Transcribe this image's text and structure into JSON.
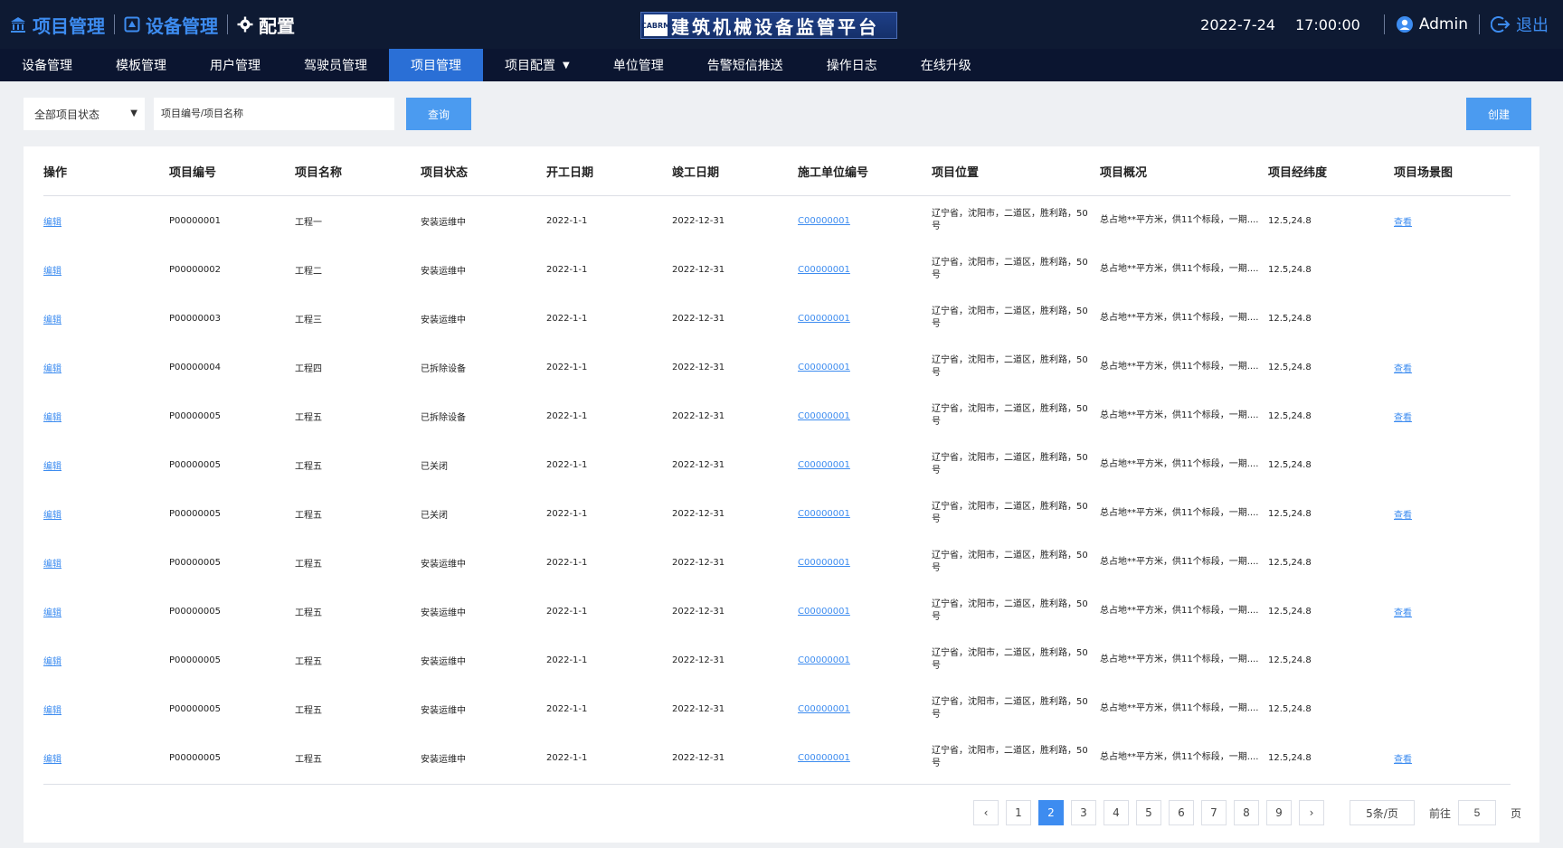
{
  "header": {
    "links": [
      {
        "label": "项目管理",
        "icon": "building-icon"
      },
      {
        "label": "设备管理",
        "icon": "device-icon"
      },
      {
        "label": "配置",
        "icon": "gear-icon"
      }
    ],
    "brand_badge": "CABRM",
    "brand_title": "建筑机械设备监管平台",
    "date": "2022-7-24",
    "time": "17:00:00",
    "user": "Admin",
    "logout": "退出"
  },
  "nav": [
    "设备管理",
    "模板管理",
    "用户管理",
    "驾驶员管理",
    "项目管理",
    "项目配置",
    "单位管理",
    "告警短信推送",
    "操作日志",
    "在线升级"
  ],
  "nav_active": "项目管理",
  "filter": {
    "status_select": "全部项目状态",
    "search_placeholder": "项目编号/项目名称",
    "query_label": "查询",
    "create_label": "创建"
  },
  "table": {
    "headers": [
      "操作",
      "项目编号",
      "项目名称",
      "项目状态",
      "开工日期",
      "竣工日期",
      "施工单位编号",
      "项目位置",
      "项目概况",
      "项目经纬度",
      "项目场景图"
    ],
    "rows": [
      {
        "action": "编辑",
        "code": "P00000001",
        "name": "工程一",
        "status": "安装运维中",
        "start": "2022-1-1",
        "end": "2022-12-31",
        "unit": "C00000001",
        "location": "辽宁省，沈阳市，二道区，胜利路，50号",
        "overview": "总占地**平方米，供11个标段，一期....",
        "coords": "12.5,24.8",
        "scene": "查看"
      },
      {
        "action": "编辑",
        "code": "P00000002",
        "name": "工程二",
        "status": "安装运维中",
        "start": "2022-1-1",
        "end": "2022-12-31",
        "unit": "C00000001",
        "location": "辽宁省，沈阳市，二道区，胜利路，50号",
        "overview": "总占地**平方米，供11个标段，一期....",
        "coords": "12.5,24.8",
        "scene": ""
      },
      {
        "action": "编辑",
        "code": "P00000003",
        "name": "工程三",
        "status": "安装运维中",
        "start": "2022-1-1",
        "end": "2022-12-31",
        "unit": "C00000001",
        "location": "辽宁省，沈阳市，二道区，胜利路，50号",
        "overview": "总占地**平方米，供11个标段，一期....",
        "coords": "12.5,24.8",
        "scene": ""
      },
      {
        "action": "编辑",
        "code": "P00000004",
        "name": "工程四",
        "status": "已拆除设备",
        "start": "2022-1-1",
        "end": "2022-12-31",
        "unit": "C00000001",
        "location": "辽宁省，沈阳市，二道区，胜利路，50号",
        "overview": "总占地**平方米，供11个标段，一期....",
        "coords": "12.5,24.8",
        "scene": "查看"
      },
      {
        "action": "编辑",
        "code": "P00000005",
        "name": "工程五",
        "status": "已拆除设备",
        "start": "2022-1-1",
        "end": "2022-12-31",
        "unit": "C00000001",
        "location": "辽宁省，沈阳市，二道区，胜利路，50号",
        "overview": "总占地**平方米，供11个标段，一期....",
        "coords": "12.5,24.8",
        "scene": "查看"
      },
      {
        "action": "编辑",
        "code": "P00000005",
        "name": "工程五",
        "status": "已关闭",
        "start": "2022-1-1",
        "end": "2022-12-31",
        "unit": "C00000001",
        "location": "辽宁省，沈阳市，二道区，胜利路，50号",
        "overview": "总占地**平方米，供11个标段，一期....",
        "coords": "12.5,24.8",
        "scene": ""
      },
      {
        "action": "编辑",
        "code": "P00000005",
        "name": "工程五",
        "status": "已关闭",
        "start": "2022-1-1",
        "end": "2022-12-31",
        "unit": "C00000001",
        "location": "辽宁省，沈阳市，二道区，胜利路，50号",
        "overview": "总占地**平方米，供11个标段，一期....",
        "coords": "12.5,24.8",
        "scene": "查看"
      },
      {
        "action": "编辑",
        "code": "P00000005",
        "name": "工程五",
        "status": "安装运维中",
        "start": "2022-1-1",
        "end": "2022-12-31",
        "unit": "C00000001",
        "location": "辽宁省，沈阳市，二道区，胜利路，50号",
        "overview": "总占地**平方米，供11个标段，一期....",
        "coords": "12.5,24.8",
        "scene": ""
      },
      {
        "action": "编辑",
        "code": "P00000005",
        "name": "工程五",
        "status": "安装运维中",
        "start": "2022-1-1",
        "end": "2022-12-31",
        "unit": "C00000001",
        "location": "辽宁省，沈阳市，二道区，胜利路，50号",
        "overview": "总占地**平方米，供11个标段，一期....",
        "coords": "12.5,24.8",
        "scene": "查看"
      },
      {
        "action": "编辑",
        "code": "P00000005",
        "name": "工程五",
        "status": "安装运维中",
        "start": "2022-1-1",
        "end": "2022-12-31",
        "unit": "C00000001",
        "location": "辽宁省，沈阳市，二道区，胜利路，50号",
        "overview": "总占地**平方米，供11个标段，一期....",
        "coords": "12.5,24.8",
        "scene": ""
      },
      {
        "action": "编辑",
        "code": "P00000005",
        "name": "工程五",
        "status": "安装运维中",
        "start": "2022-1-1",
        "end": "2022-12-31",
        "unit": "C00000001",
        "location": "辽宁省，沈阳市，二道区，胜利路，50号",
        "overview": "总占地**平方米，供11个标段，一期....",
        "coords": "12.5,24.8",
        "scene": ""
      },
      {
        "action": "编辑",
        "code": "P00000005",
        "name": "工程五",
        "status": "安装运维中",
        "start": "2022-1-1",
        "end": "2022-12-31",
        "unit": "C00000001",
        "location": "辽宁省，沈阳市，二道区，胜利路，50号",
        "overview": "总占地**平方米，供11个标段，一期....",
        "coords": "12.5,24.8",
        "scene": "查看"
      }
    ]
  },
  "pagination": {
    "prev": "‹",
    "pages": [
      "1",
      "2",
      "3",
      "4",
      "5",
      "6",
      "7",
      "8",
      "9"
    ],
    "current": "2",
    "next": "›",
    "page_size": "5条/页",
    "goto_label": "前往",
    "goto_value": "5",
    "page_unit": "页"
  },
  "colors": {
    "header_bg": "#0e1a33",
    "nav_bg": "#0b1530",
    "accent": "#3d8cf0",
    "nav_active": "#2a6fd6"
  }
}
